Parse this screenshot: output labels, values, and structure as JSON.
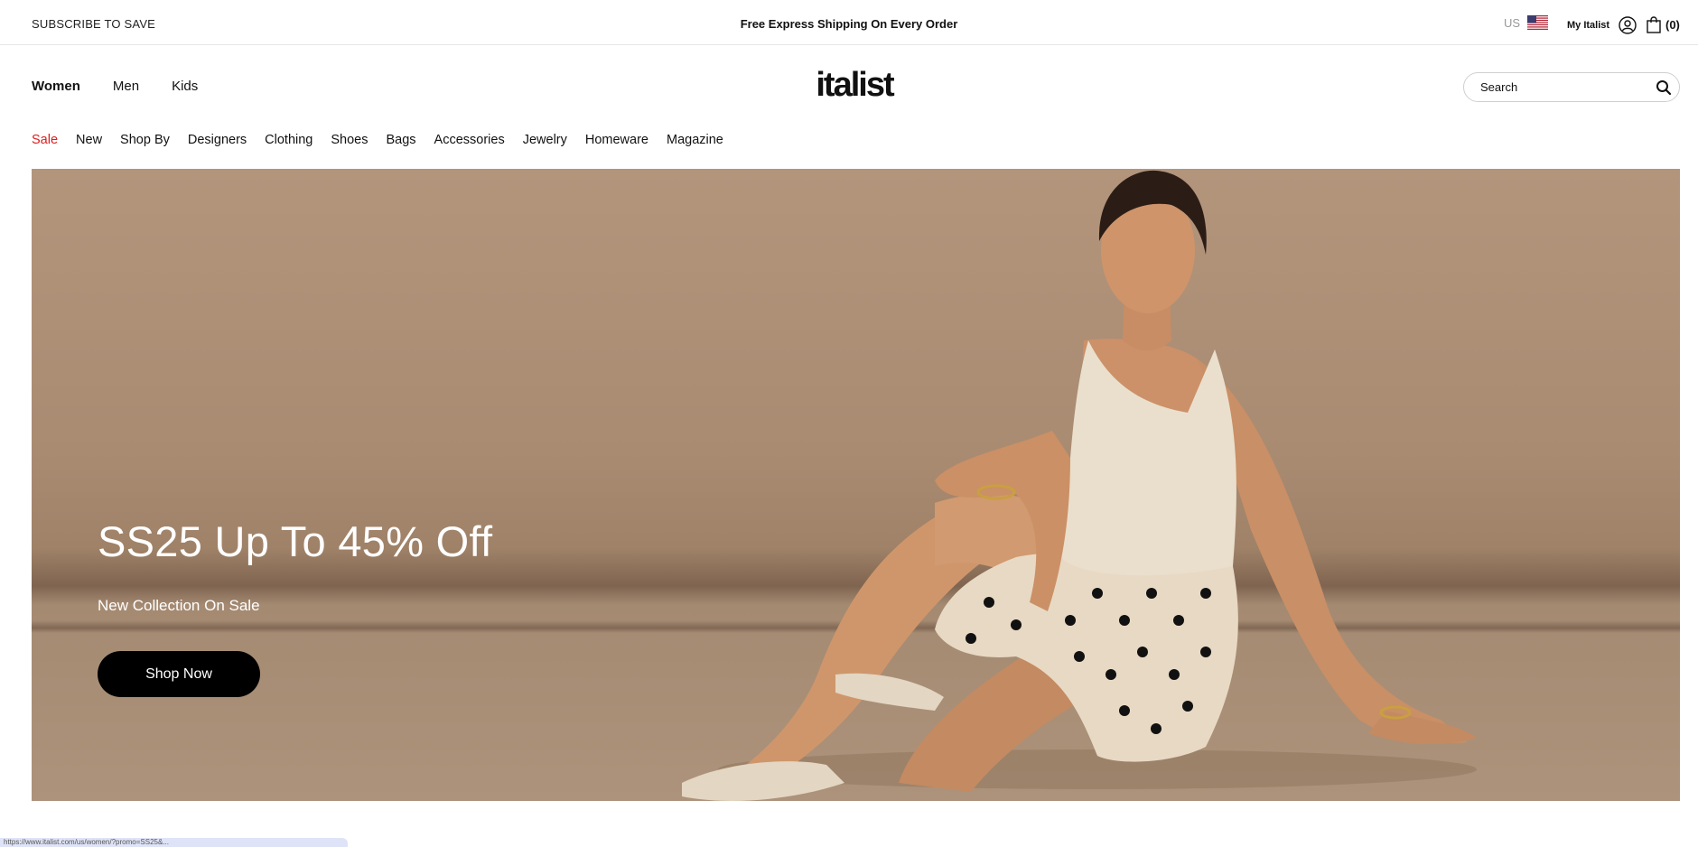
{
  "topbar": {
    "subscribe": "SUBSCRIBE TO SAVE",
    "shipping": "Free Express Shipping On Every Order",
    "country": "US",
    "account_label": "My Italist",
    "cart_count": "(0)"
  },
  "header": {
    "logo_text": "italist",
    "departments": [
      "Women",
      "Men",
      "Kids"
    ],
    "active_department": "Women",
    "search_placeholder": "Search"
  },
  "category_nav": [
    "Sale",
    "New",
    "Shop By",
    "Designers",
    "Clothing",
    "Shoes",
    "Bags",
    "Accessories",
    "Jewelry",
    "Homeware",
    "Magazine"
  ],
  "hero": {
    "title": "SS25 Up To 45% Off",
    "subtitle": "New Collection On Sale",
    "cta": "Shop Now"
  },
  "status_bar": {
    "url": "https://www.italist.com/us/women/?promo=SS25&..."
  },
  "colors": {
    "sale": "#e01b1b",
    "cta_bg": "#000000",
    "hero_bg": "#a98b72"
  }
}
